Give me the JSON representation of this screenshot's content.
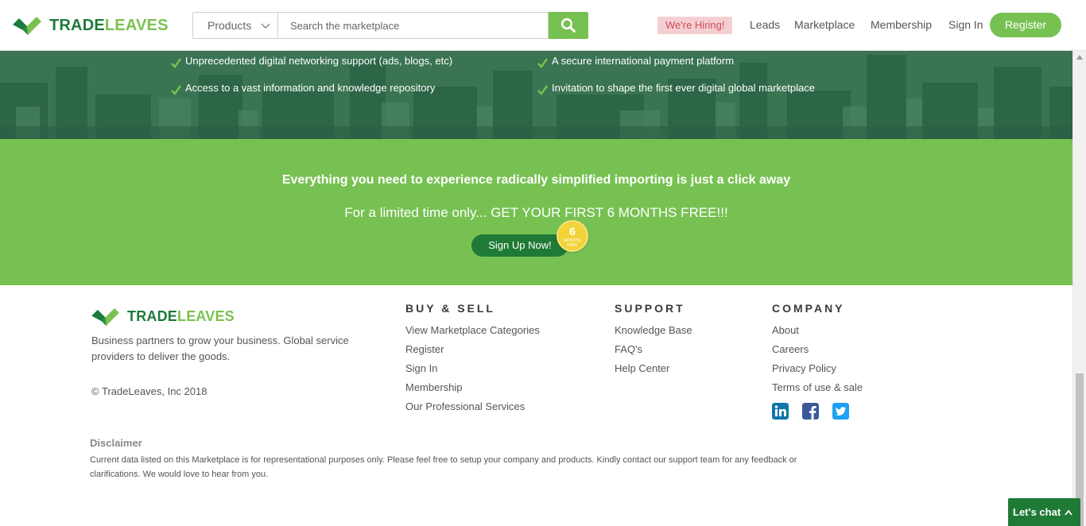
{
  "header": {
    "logo_part1": "TRADE",
    "logo_part2": "LEAVES",
    "category_selected": "Products",
    "search_placeholder": "Search the marketplace",
    "hiring_label": "We're Hiring!",
    "nav": [
      "Leads",
      "Marketplace",
      "Membership",
      "Sign In"
    ],
    "register_label": "Register"
  },
  "hero": {
    "features_left": [
      "Unprecedented digital networking support (ads, blogs, etc)",
      "Access to a vast information and knowledge repository"
    ],
    "features_right": [
      "A secure international payment platform",
      "Invitation to shape the first ever digital global marketplace"
    ]
  },
  "cta": {
    "line1": "Everything you need to experience radically simplified importing is just a click away",
    "line2": "For a limited time only... GET YOUR FIRST 6 MONTHS FREE!!!",
    "button_label": "Sign Up Now!",
    "badge_number": "6",
    "badge_text": "MONTHS FREE"
  },
  "footer": {
    "logo_part1": "TRADE",
    "logo_part2": "LEAVES",
    "tagline": "Business partners to grow your business. Global service providers to deliver the goods.",
    "copyright": "© TradeLeaves, Inc 2018",
    "columns": [
      {
        "title": "BUY & SELL",
        "links": [
          "View Marketplace Categories",
          "Register",
          "Sign In",
          "Membership",
          "Our Professional Services"
        ]
      },
      {
        "title": "SUPPORT",
        "links": [
          "Knowledge Base",
          "FAQ's",
          "Help Center"
        ]
      },
      {
        "title": "COMPANY",
        "links": [
          "About",
          "Careers",
          "Privacy Policy",
          "Terms of use & sale"
        ]
      }
    ],
    "social": [
      "linkedin-icon",
      "facebook-icon",
      "twitter-icon"
    ],
    "disclaimer_title": "Disclaimer",
    "disclaimer_text": "Current data listed on this Marketplace is for representational purposes only. Please feel free to setup your company and products. Kindly contact our support team for any feedback or clarifications. We would love to hear from you."
  },
  "chat": {
    "label": "Let's chat"
  },
  "colors": {
    "brand_dark": "#1e7a3c",
    "brand_light": "#77c152",
    "hiring_bg": "#f4cfd2",
    "hiring_text": "#cf4b5a"
  }
}
